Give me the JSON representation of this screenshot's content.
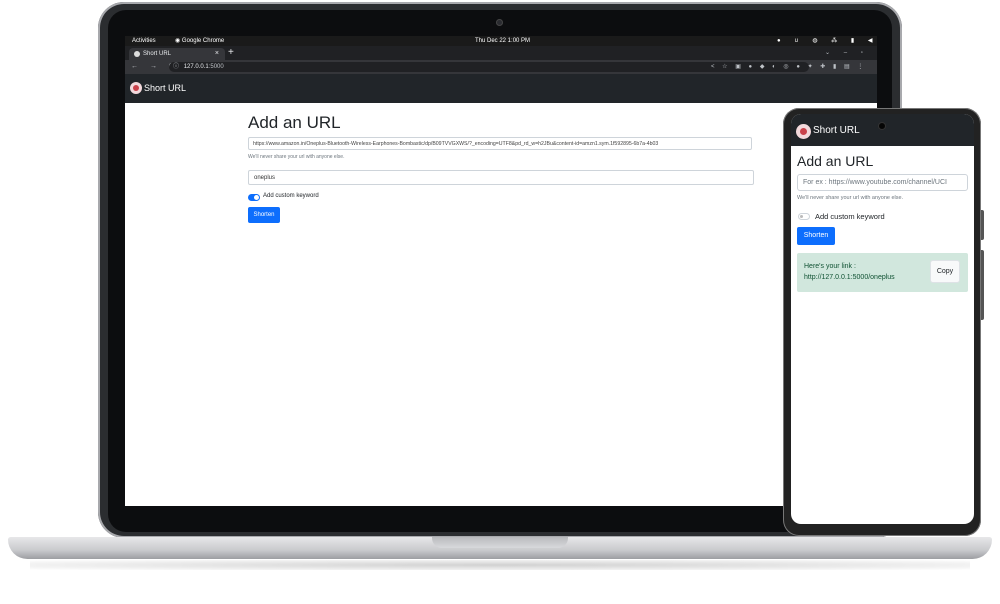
{
  "os": {
    "activities": "Activities",
    "app_name": "Google Chrome",
    "clock": "Thu Dec 22  1:00 PM"
  },
  "browser": {
    "tab_title": "Short URL",
    "tab_close": "×",
    "new_tab": "+",
    "nav_icons": "← → C",
    "info_icon": "ⓘ",
    "url_host": "127.0.0.1",
    "url_port": ":5000",
    "ext_icons": "< ☆ ▣ ● ◆ ◐ ◎ ● ✦ ✚ ▮ ▤ ⋮"
  },
  "app": {
    "brand": "Short URL"
  },
  "desktop": {
    "heading": "Add an URL",
    "url_value": "https://www.amazon.in/Oneplus-Bluetooth-Wireless-Earphones-Bombastic/dp/B09TVVGXWS/?_encoding=UTF8&pd_rd_w=h2JBu&content-id=amzn1.sym.1f592895-6b7a-4b03",
    "help_text": "We'll never share your url with anyone else.",
    "keyword_value": "oneplus",
    "toggle_label": "Add custom keyword",
    "toggle_on": true,
    "shorten_label": "Shorten"
  },
  "mobile": {
    "heading": "Add an URL",
    "url_placeholder": "For ex : https://www.youtube.com/channel/UCI",
    "help_text": "We'll never share your url with anyone else.",
    "toggle_label": "Add custom keyword",
    "toggle_on": false,
    "shorten_label": "Shorten",
    "result_label": "Here's your link :",
    "result_link": "http://127.0.0.1:5000/oneplus",
    "copy_label": "Copy"
  },
  "colors": {
    "navbar": "#212529",
    "primary": "#0d6efd",
    "success_bg": "#d1e7dd"
  }
}
